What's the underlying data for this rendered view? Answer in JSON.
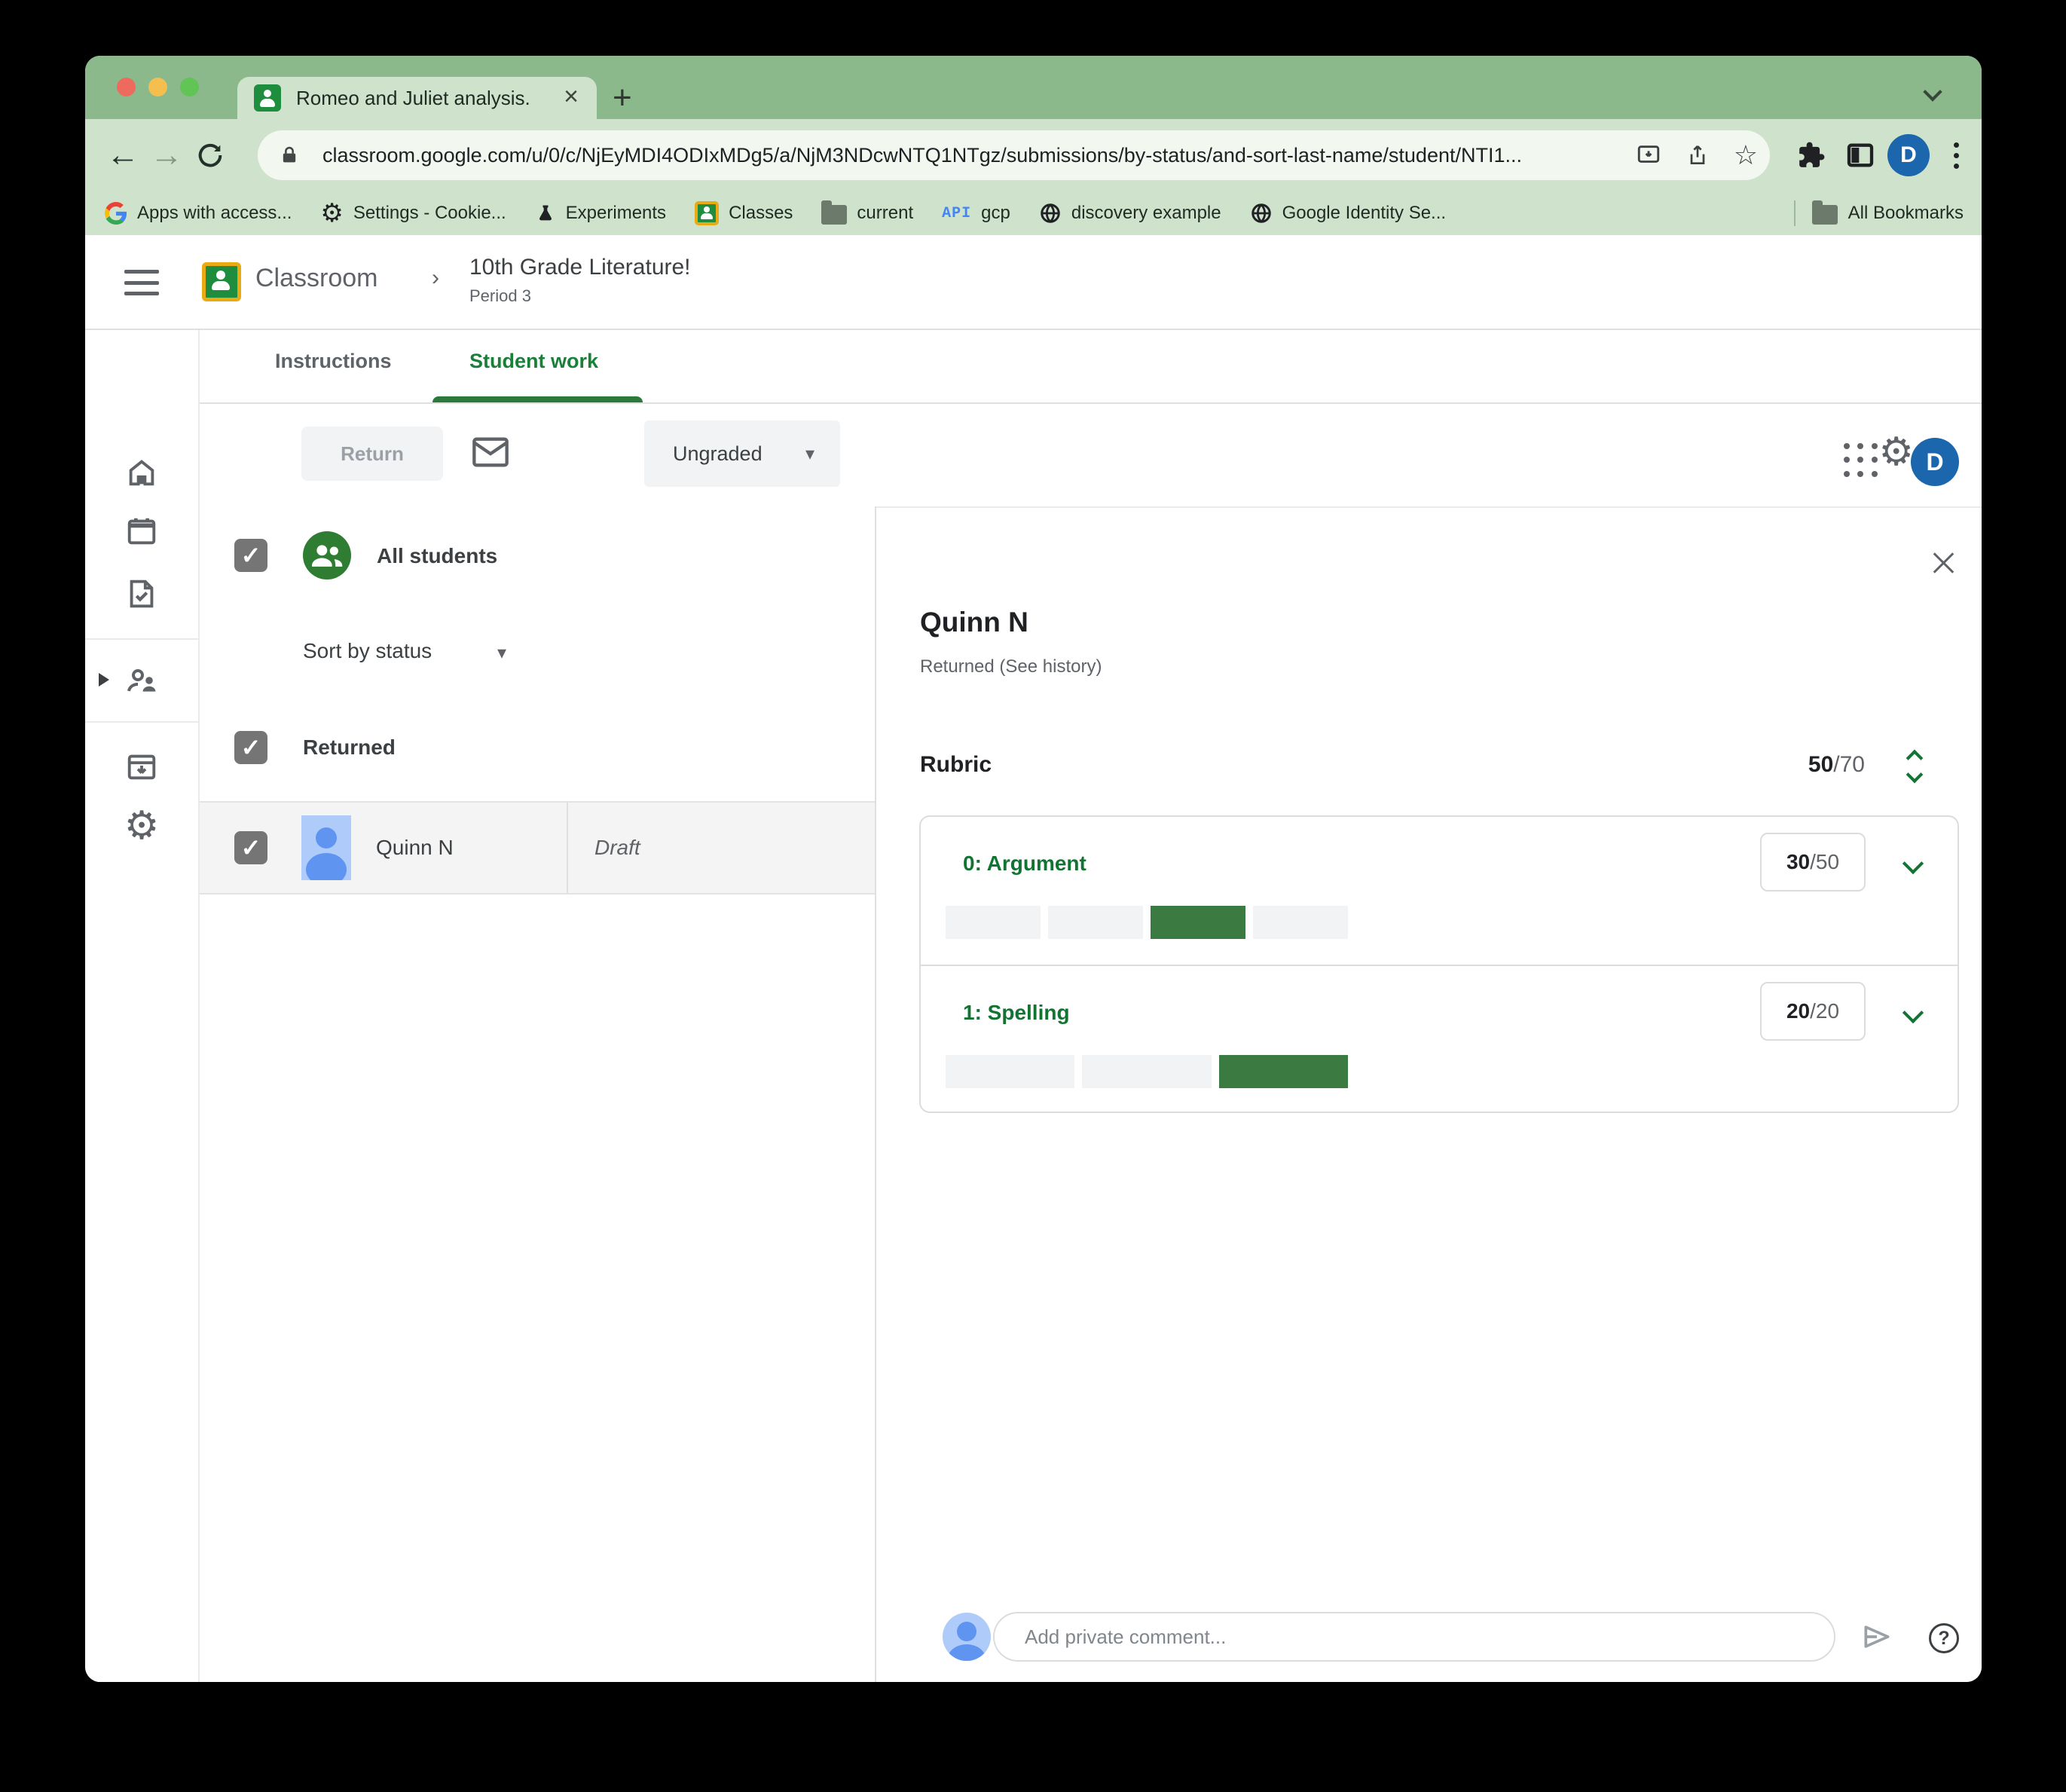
{
  "browser": {
    "tab_title": "Romeo and Juliet analysis.",
    "url": "classroom.google.com/u/0/c/NjEyMDI4ODIxMDg5/a/NjM3NDcwNTQ1NTgz/submissions/by-status/and-sort-last-name/student/NTI1...",
    "profile_initial": "D",
    "bookmarks": [
      "Apps with access...",
      "Settings - Cookie...",
      "Experiments",
      "Classes",
      "current",
      "gcp",
      "discovery example",
      "Google Identity Se..."
    ],
    "all_bookmarks_label": "All Bookmarks"
  },
  "header": {
    "app_name": "Classroom",
    "breadcrumb_separator": "›",
    "course_title": "10th Grade Literature!",
    "course_subtitle": "Period 3",
    "profile_initial": "D"
  },
  "work_tabs": {
    "instructions": "Instructions",
    "student_work": "Student work"
  },
  "toolbar": {
    "return_label": "Return",
    "grade_filter_value": "Ungraded",
    "caret": "▾"
  },
  "student_list": {
    "all_students_label": "All students",
    "sort_label": "Sort by status",
    "sort_caret": "▾",
    "group_label": "Returned",
    "students": [
      {
        "name": "Quinn N",
        "status": "Draft"
      }
    ]
  },
  "grading_panel": {
    "student_name": "Quinn N",
    "status_line": "Returned (See history)",
    "rubric_label": "Rubric",
    "total_score": "50",
    "total_outof": "/70",
    "criteria": [
      {
        "title": "0: Argument",
        "score": "30",
        "outof": "/50",
        "levels": 4,
        "selected": 3
      },
      {
        "title": "1: Spelling",
        "score": "20",
        "outof": "/20",
        "levels": 3,
        "selected": 3
      }
    ],
    "comment_placeholder": "Add private comment..."
  },
  "colors": {
    "tab_strip_green": "#8bb98c",
    "toolbar_green": "#cfe3cc",
    "classroom_accent_green": "#188038",
    "rubric_title_green": "#137333",
    "rubric_fill_green": "#3b7a40",
    "avatar_blue": "#aecbfa",
    "profile_blue": "#1b66ad"
  }
}
